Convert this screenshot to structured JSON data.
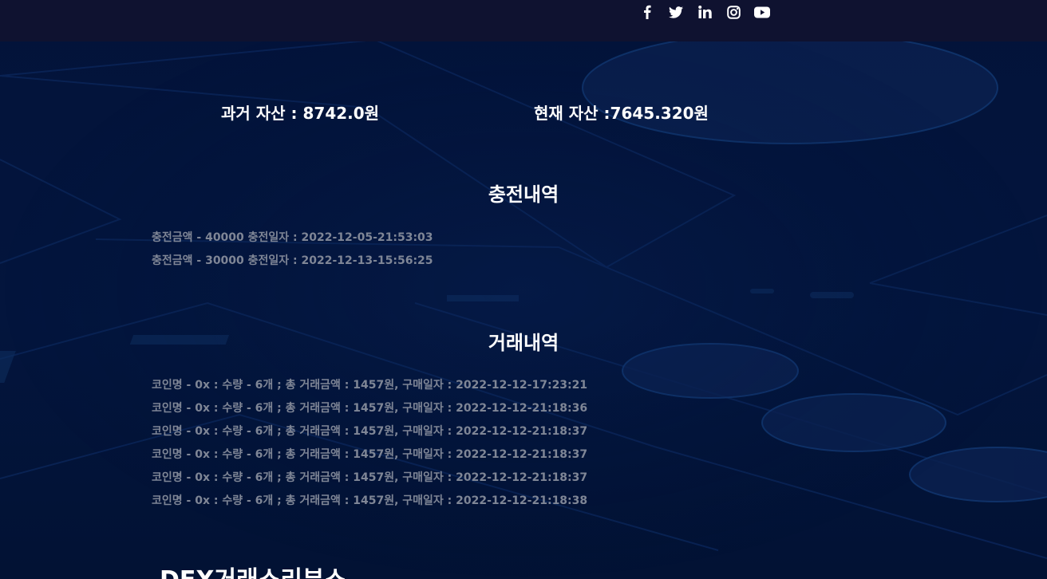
{
  "social": [
    {
      "name": "facebook-icon",
      "label": "f"
    },
    {
      "name": "twitter-icon",
      "label": "twitter"
    },
    {
      "name": "linkedin-icon",
      "label": "in"
    },
    {
      "name": "instagram-icon",
      "label": "instagram"
    },
    {
      "name": "youtube-icon",
      "label": "youtube"
    }
  ],
  "assets": {
    "past": "과거 자산 : 8742.0원",
    "current": "현재 자산 :7645.320원"
  },
  "charge": {
    "title": "충전내역",
    "items": [
      "충전금액 - 40000 충전일자 : 2022-12-05-21:53:03",
      "충전금액 - 30000 충전일자 : 2022-12-13-15:56:25"
    ]
  },
  "trade": {
    "title": "거래내역",
    "items": [
      "코인명 - 0x : 수량 - 6개 ; 총 거래금액 : 1457원, 구매일자 : 2022-12-12-17:23:21",
      "코인명 - 0x : 수량 - 6개 ; 총 거래금액 : 1457원, 구매일자 : 2022-12-12-21:18:36",
      "코인명 - 0x : 수량 - 6개 ; 총 거래금액 : 1457원, 구매일자 : 2022-12-12-21:18:37",
      "코인명 - 0x : 수량 - 6개 ; 총 거래금액 : 1457원, 구매일자 : 2022-12-12-21:18:37",
      "코인명 - 0x : 수량 - 6개 ; 총 거래금액 : 1457원, 구매일자 : 2022-12-12-21:18:37",
      "코인명 - 0x : 수량 - 6개 ; 총 거래금액 : 1457원, 구매일자 : 2022-12-12-21:18:38"
    ]
  },
  "bottom_heading": "DEX거래소리뷰스"
}
